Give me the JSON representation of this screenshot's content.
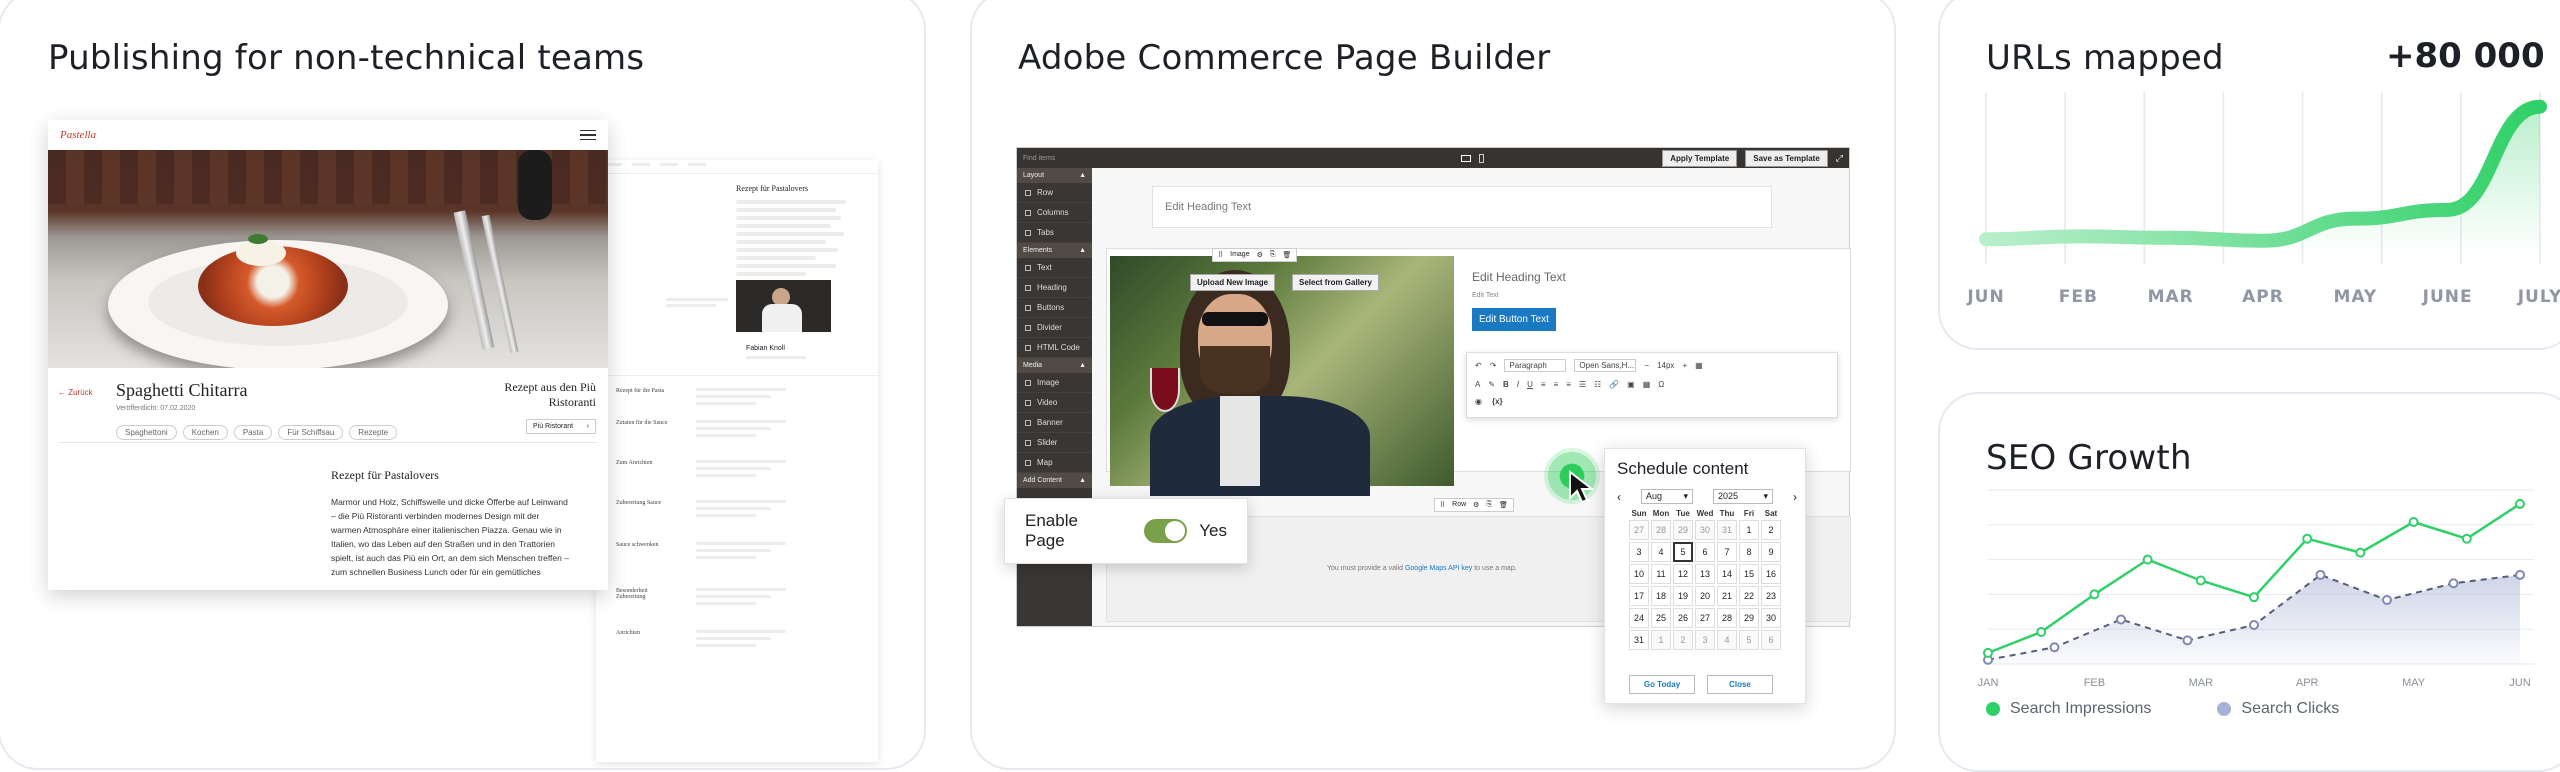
{
  "card1": {
    "title": "Publishing for non-technical teams",
    "recipe": {
      "logo": "Pastella",
      "back": "← Zurück",
      "title": "Spaghetti Chitarra",
      "date": "Veröffentlicht: 07.02.2020",
      "tags": [
        "Spaghettoni",
        "Kochen",
        "Pasta",
        "Für Schiffsau",
        "Rezepte"
      ],
      "right_title": "Rezept aus den Più Ristoranti",
      "right_button": "Più Ristorant",
      "section_heading": "Rezept für Pastalovers",
      "body": "Marmor und Holz, Schiffswelle und dicke Öfferbe auf Leinwand – die Più Ristoranti verbinden modernes Design mit der warmen Atmosphäre einer italienischen Piazza. Genau wie in Italien, wo das Leben auf den Straßen und in den Trattorien spielt, ist auch das Più ein Ort, an dem sich Menschen treffen – zum schnellen Business Lunch oder für ein gemütliches"
    },
    "cms": {
      "heading": "Rezept für Pastalovers",
      "chef_name": "Fabian Knoll",
      "rows": [
        "Rezept für die Pasta",
        "Zutaten für die Sauce",
        "Zum Anrichten",
        "Zubereitung Sauce",
        "Sauce schwenken",
        "Besonderheit Zubereitung",
        "Anrichten"
      ]
    }
  },
  "card2": {
    "title": "Adobe Commerce Page Builder",
    "toolbar": {
      "search": "Find items",
      "apply_template": "Apply Template",
      "save_template": "Save as Template"
    },
    "sidebar": {
      "sections": [
        {
          "label": "Layout",
          "items": [
            "Row",
            "Columns",
            "Tabs"
          ]
        },
        {
          "label": "Elements",
          "items": [
            "Text",
            "Heading",
            "Buttons",
            "Divider",
            "HTML Code"
          ]
        },
        {
          "label": "Media",
          "items": [
            "Image",
            "Video",
            "Banner",
            "Slider",
            "Map"
          ]
        },
        {
          "label": "Add Content",
          "items": []
        }
      ]
    },
    "canvas": {
      "heading_placeholder": "Edit Heading Text",
      "image_label": "Image",
      "upload_image": "Upload New Image",
      "select_gallery": "Select from Gallery",
      "heading_placeholder2": "Edit Heading Text",
      "text_placeholder": "Edit Text",
      "button_text": "Edit Button Text",
      "rte": {
        "format": "Paragraph",
        "font": "Open Sans,H...",
        "size": "14px",
        "variable": "{x}"
      },
      "row_label": "Row",
      "map_note_pre": "You must provide a valid ",
      "map_note_link": "Google Maps API key",
      "map_note_post": " to use a map."
    },
    "enable_page": {
      "label": "Enable Page",
      "value": "Yes"
    },
    "schedule": {
      "title": "Schedule content",
      "month": "Aug",
      "year": "2025",
      "weekdays": [
        "Sun",
        "Mon",
        "Tue",
        "Wed",
        "Thu",
        "Fri",
        "Sat"
      ],
      "days": [
        [
          "27",
          "28",
          "29",
          "30",
          "31",
          "1",
          "2"
        ],
        [
          "3",
          "4",
          "5",
          "6",
          "7",
          "8",
          "9"
        ],
        [
          "10",
          "11",
          "12",
          "13",
          "14",
          "15",
          "16"
        ],
        [
          "17",
          "18",
          "19",
          "20",
          "21",
          "22",
          "23"
        ],
        [
          "24",
          "25",
          "26",
          "27",
          "28",
          "29",
          "30"
        ],
        [
          "31",
          "1",
          "2",
          "3",
          "4",
          "5",
          "6"
        ]
      ],
      "selected": "5",
      "go_today": "Go Today",
      "close": "Close"
    }
  },
  "card3": {
    "title": "URLs mapped",
    "value": "+80 000",
    "months": [
      "JUN",
      "FEB",
      "MAR",
      "APR",
      "MAY",
      "JUNE",
      "JULY"
    ],
    "accent": "#3bd16f"
  },
  "card4": {
    "title": "SEO Growth",
    "months": [
      "JAN",
      "FEB",
      "MAR",
      "APR",
      "MAY",
      "JUN"
    ],
    "legend": [
      {
        "name": "Search Impressions",
        "color": "#2fd067"
      },
      {
        "name": "Search Clicks",
        "color": "#a8b2d6"
      }
    ]
  },
  "chart_data": [
    {
      "type": "area",
      "title": "URLs mapped",
      "categories": [
        "JUN",
        "FEB",
        "MAR",
        "APR",
        "MAY",
        "JUNE",
        "JULY"
      ],
      "series": [
        {
          "values": [
            10,
            12,
            11,
            9,
            24,
            30,
            100
          ]
        }
      ],
      "grid": true,
      "ylim": [
        0,
        110
      ]
    },
    {
      "type": "line",
      "title": "SEO Growth",
      "categories": [
        "JAN",
        "FEB",
        "MAR",
        "APR",
        "MAY",
        "JUN"
      ],
      "series": [
        {
          "name": "Search Impressions",
          "values": [
            8,
            23,
            50,
            75,
            60,
            48,
            90,
            80,
            102,
            90,
            115
          ]
        },
        {
          "name": "Search Clicks",
          "values": [
            3,
            12,
            32,
            17,
            28,
            64,
            46,
            58,
            64
          ]
        }
      ],
      "grid": true,
      "legend": "bottom"
    }
  ]
}
